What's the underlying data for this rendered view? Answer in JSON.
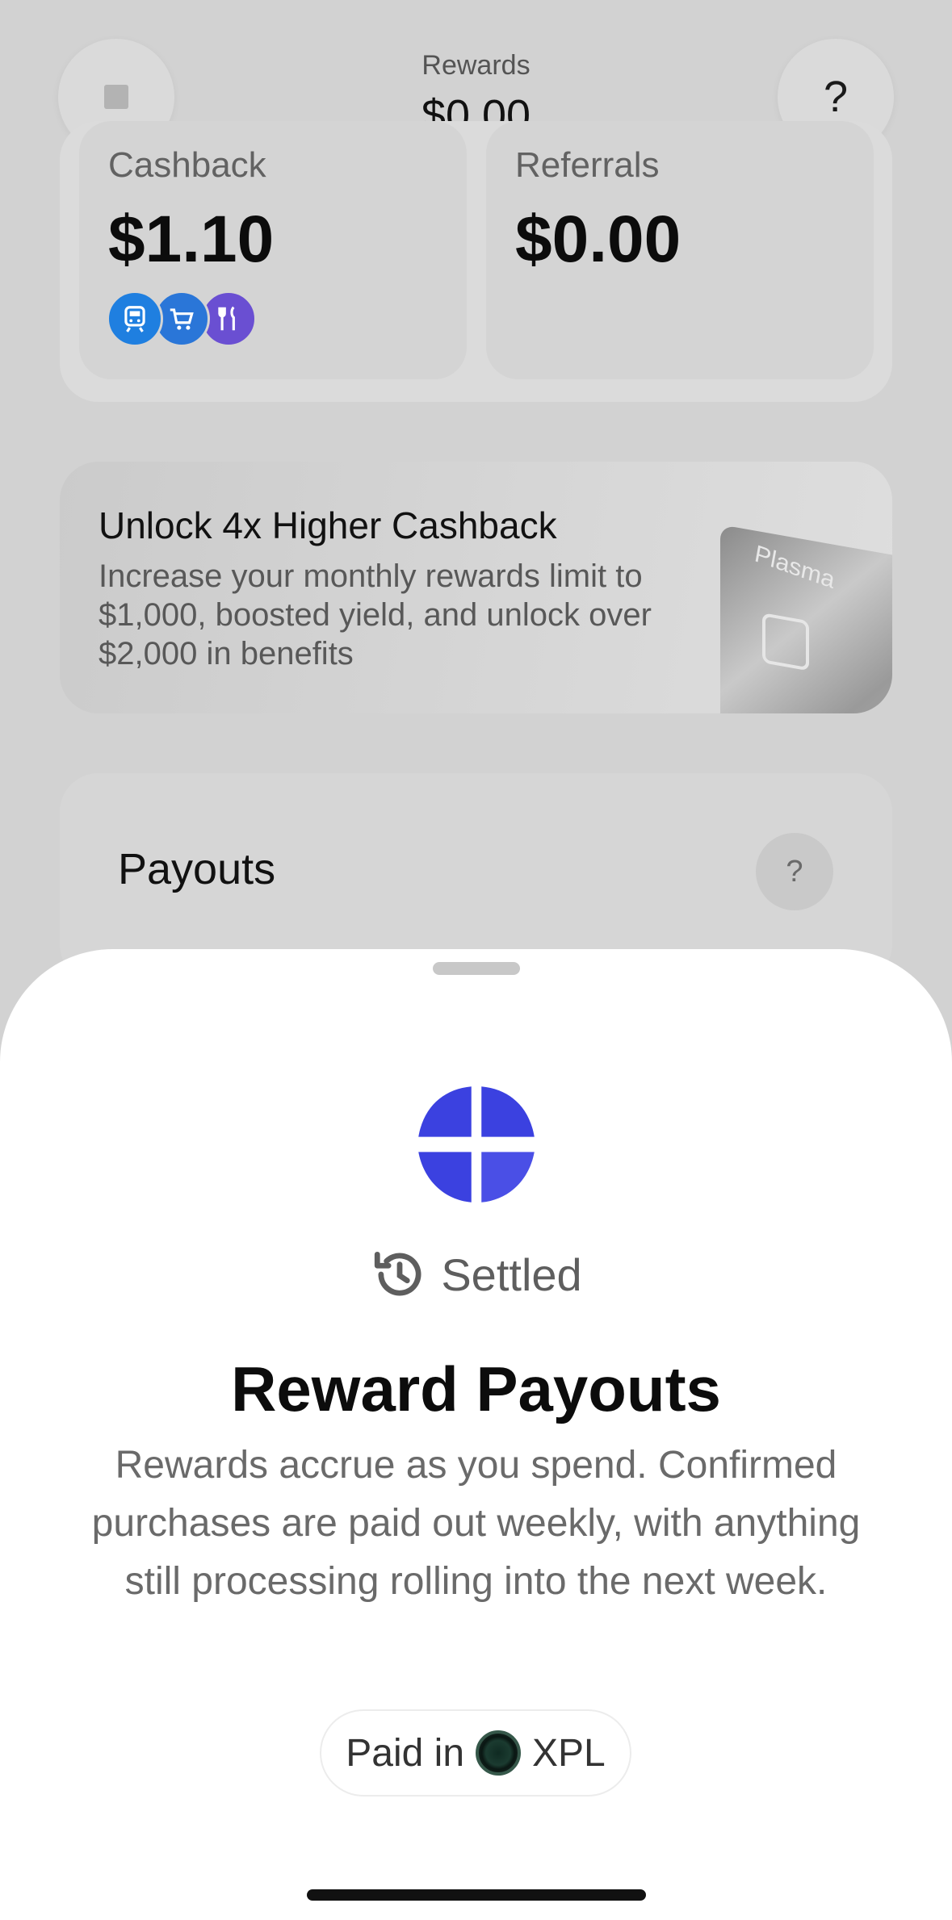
{
  "header": {
    "title": "Rewards",
    "amount": "$0.00",
    "stop_icon": "stop-icon",
    "help_label": "?"
  },
  "summary": {
    "cashback": {
      "label": "Cashback",
      "value": "$1.10",
      "category_icons": [
        {
          "name": "train-icon",
          "glyph": "🚆",
          "color": "#1f7fe0"
        },
        {
          "name": "cart-icon",
          "glyph": "🛒",
          "color": "#2a76d8"
        },
        {
          "name": "fork-knife-icon",
          "glyph": "🍴",
          "color": "#6a4fd2"
        }
      ]
    },
    "referrals": {
      "label": "Referrals",
      "value": "$0.00"
    }
  },
  "upsell": {
    "title": "Unlock 4x Higher Cashback",
    "description": "Increase your monthly rewards limit to $1,000, boosted yield, and unlock over $2,000 in benefits",
    "card_brand": "Plasma"
  },
  "payouts": {
    "title": "Payouts",
    "help_label": "?"
  },
  "sheet": {
    "status_icon": "history-icon",
    "status_label": "Settled",
    "title": "Reward Payouts",
    "description": "Rewards accrue as you spend. Confirmed purchases are paid out weekly, with anything still processing rolling into the next week.",
    "paid_in_prefix": "Paid in",
    "token": "XPL",
    "accent_color": "#3b41e0"
  }
}
